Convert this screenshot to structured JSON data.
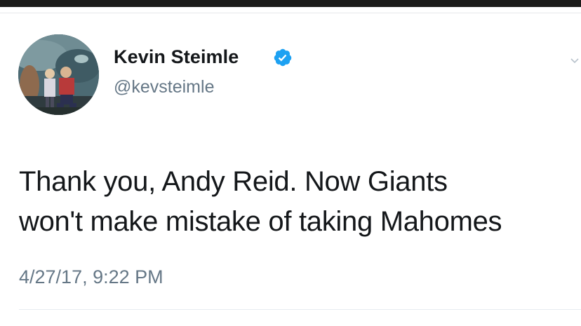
{
  "tweet": {
    "author": {
      "display_name": "Kevin Steimle",
      "handle": "@kevsteimle",
      "verified": true,
      "avatar_icon": "profile-photo-aquarium"
    },
    "text_lines": [
      "Thank you, Andy Reid. Now Giants",
      "won't make mistake of taking Mahomes"
    ],
    "timestamp": "4/27/17, 9:22 PM",
    "menu_icon": "chevron-down-icon"
  },
  "colors": {
    "text_primary": "#14171a",
    "text_secondary": "#657786",
    "verified_badge": "#1da1f2",
    "divider": "#e6ecf0",
    "top_bar": "#1c1c1a"
  }
}
